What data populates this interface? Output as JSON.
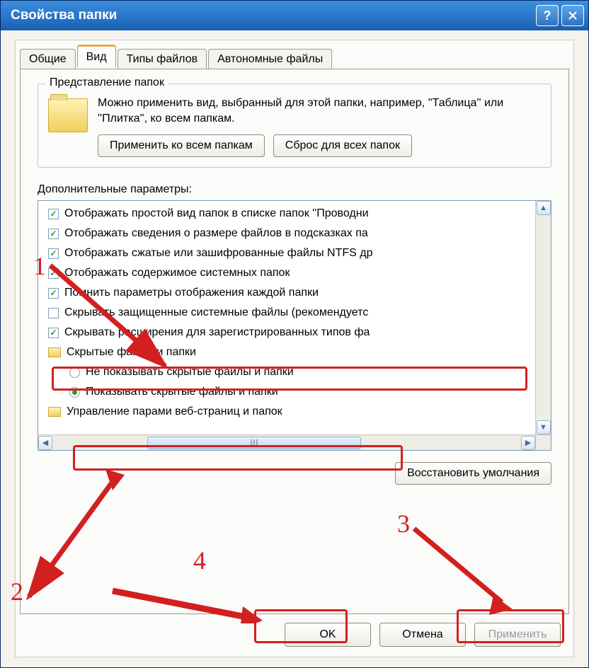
{
  "window": {
    "title": "Свойства папки"
  },
  "tabs": {
    "general": "Общие",
    "view": "Вид",
    "filetypes": "Типы файлов",
    "offline": "Автономные файлы",
    "active": "view"
  },
  "groupbox": {
    "title": "Представление папок",
    "description": "Можно применить вид, выбранный для этой папки, например, ''Таблица'' или ''Плитка'', ко всем папкам.",
    "apply_all": "Применить ко всем папкам",
    "reset_all": "Сброс для всех папок"
  },
  "section_label": "Дополнительные параметры:",
  "options": [
    {
      "kind": "check",
      "checked": true,
      "label": "Отображать простой вид папок в списке папок ''Проводни"
    },
    {
      "kind": "check",
      "checked": true,
      "label": "Отображать сведения о размере файлов в подсказках па"
    },
    {
      "kind": "check",
      "checked": true,
      "label": "Отображать сжатые или зашифрованные файлы NTFS др"
    },
    {
      "kind": "check",
      "checked": true,
      "label": "Отображать содержимое системных папок"
    },
    {
      "kind": "check",
      "checked": true,
      "label": "Помнить параметры отображения каждой папки"
    },
    {
      "kind": "check",
      "checked": false,
      "label": "Скрывать защищенные системные файлы (рекомендуетс"
    },
    {
      "kind": "check",
      "checked": true,
      "label": "Скрывать расширения для зарегистрированных типов фа"
    },
    {
      "kind": "folder",
      "label": "Скрытые файлы и папки"
    },
    {
      "kind": "radio",
      "checked": false,
      "indent": true,
      "label": "Не показывать скрытые файлы и папки"
    },
    {
      "kind": "radio",
      "checked": true,
      "indent": true,
      "label": "Показывать скрытые файлы и папки"
    },
    {
      "kind": "folder",
      "label": "Управление парами веб-страниц и папок"
    }
  ],
  "restore_defaults": "Восстановить умолчания",
  "buttons": {
    "ok": "OK",
    "cancel": "Отмена",
    "apply": "Применить"
  },
  "annotations": {
    "n1": "1",
    "n2": "2",
    "n3": "3",
    "n4": "4"
  }
}
